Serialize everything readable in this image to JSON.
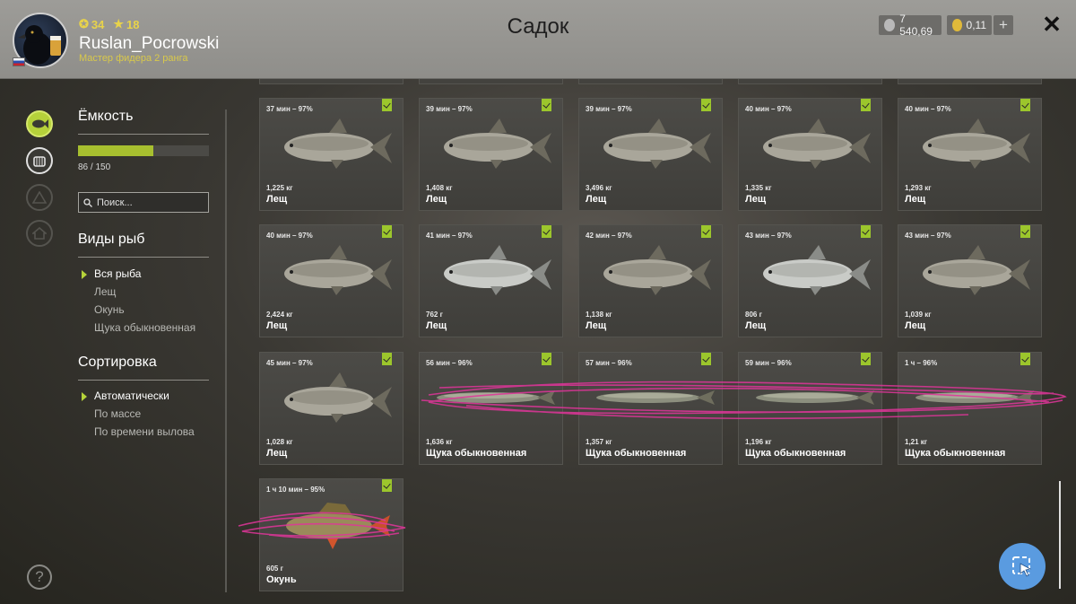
{
  "header": {
    "title": "Садок",
    "user": {
      "level": "34",
      "stars": "18",
      "name": "Ruslan_Pocrowski",
      "rank": "Мастер фидера 2 ранга"
    },
    "silver": "7 540,69",
    "gold": "0,11",
    "plus_label": "+",
    "close_label": "✕"
  },
  "sidebar": {
    "icons": [
      "fish-tab-icon",
      "fishkeeper-tab-icon",
      "tent-tab-icon",
      "home-tab-icon"
    ],
    "help_label": "?"
  },
  "filters": {
    "capacity_title": "Ёмкость",
    "capacity_used": 86,
    "capacity_max": 150,
    "capacity_text": "86 / 150",
    "search_placeholder": "Поиск...",
    "species_title": "Виды рыб",
    "species": [
      {
        "label": "Вся рыба",
        "selected": true
      },
      {
        "label": "Лещ",
        "selected": false
      },
      {
        "label": "Окунь",
        "selected": false
      },
      {
        "label": "Щука обыкновенная",
        "selected": false
      }
    ],
    "sort_title": "Сортировка",
    "sort": [
      {
        "label": "Автоматически",
        "selected": true
      },
      {
        "label": "По массе",
        "selected": false
      },
      {
        "label": "По времени вылова",
        "selected": false
      }
    ]
  },
  "catch": [
    {
      "time": "37 мин – 97%",
      "weight": "1,225 кг",
      "name": "Лещ",
      "kind": "bream"
    },
    {
      "time": "39 мин – 97%",
      "weight": "1,408 кг",
      "name": "Лещ",
      "kind": "bream"
    },
    {
      "time": "39 мин – 97%",
      "weight": "3,496 кг",
      "name": "Лещ",
      "kind": "bream"
    },
    {
      "time": "40 мин – 97%",
      "weight": "1,335 кг",
      "name": "Лещ",
      "kind": "bream"
    },
    {
      "time": "40 мин – 97%",
      "weight": "1,293 кг",
      "name": "Лещ",
      "kind": "bream"
    },
    {
      "time": "40 мин – 97%",
      "weight": "2,424 кг",
      "name": "Лещ",
      "kind": "bream"
    },
    {
      "time": "41 мин – 97%",
      "weight": "762 г",
      "name": "Лещ",
      "kind": "bream-silver"
    },
    {
      "time": "42 мин – 97%",
      "weight": "1,138 кг",
      "name": "Лещ",
      "kind": "bream"
    },
    {
      "time": "43 мин – 97%",
      "weight": "806 г",
      "name": "Лещ",
      "kind": "bream-silver"
    },
    {
      "time": "43 мин – 97%",
      "weight": "1,039 кг",
      "name": "Лещ",
      "kind": "bream"
    },
    {
      "time": "45 мин – 97%",
      "weight": "1,028 кг",
      "name": "Лещ",
      "kind": "bream"
    },
    {
      "time": "56 мин – 96%",
      "weight": "1,636 кг",
      "name": "Щука обыкновенная",
      "kind": "pike"
    },
    {
      "time": "57 мин – 96%",
      "weight": "1,357 кг",
      "name": "Щука обыкновенная",
      "kind": "pike"
    },
    {
      "time": "59 мин – 96%",
      "weight": "1,196 кг",
      "name": "Щука обыкновенная",
      "kind": "pike"
    },
    {
      "time": "1 ч – 96%",
      "weight": "1,21 кг",
      "name": "Щука обыкновенная",
      "kind": "pike"
    },
    {
      "time": "1 ч 10 мин – 95%",
      "weight": "605 г",
      "name": "Окунь",
      "kind": "perch"
    }
  ],
  "colors": {
    "accent": "#a7bf2f",
    "badge": "#9cc62c",
    "scribble": "#e0359a",
    "cursor_button": "#5a9be0"
  }
}
